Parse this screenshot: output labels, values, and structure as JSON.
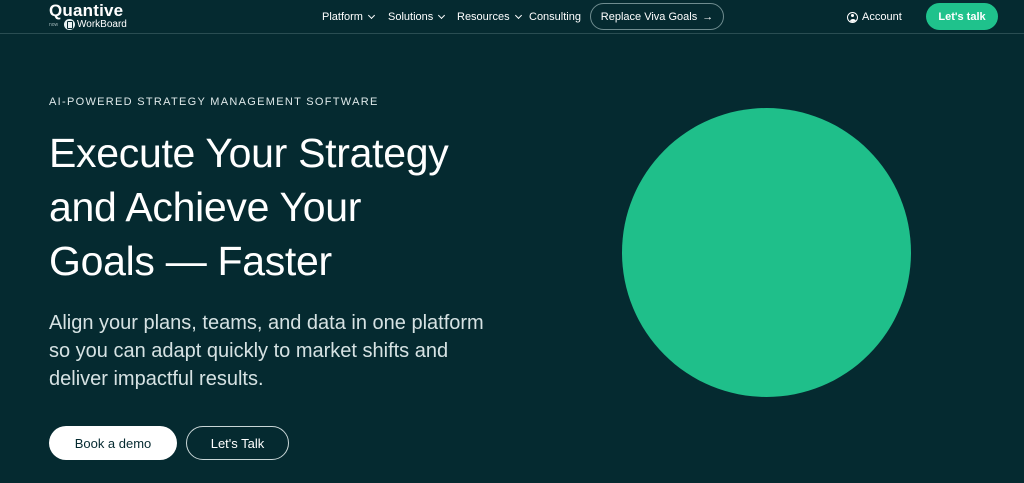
{
  "nav": {
    "logo": {
      "name": "Quantive",
      "now": "now",
      "partner": "WorkBoard"
    },
    "items": [
      {
        "label": "Platform"
      },
      {
        "label": "Solutions"
      },
      {
        "label": "Resources"
      },
      {
        "label": "Consulting"
      }
    ],
    "replace_label": "Replace Viva Goals",
    "replace_arrow": "→",
    "account_label": "Account",
    "cta_label": "Let's talk"
  },
  "hero": {
    "eyebrow": "AI-POWERED STRATEGY MANAGEMENT SOFTWARE",
    "headline_lines": [
      "Execute Your Strategy",
      "and Achieve Your",
      "Goals — Faster"
    ],
    "subtext_lines": [
      "Align your plans, teams, and data in one platform",
      "so you can adapt quickly to market shifts and",
      "deliver impactful results."
    ],
    "primary_button": "Book a demo",
    "secondary_button": "Let's Talk"
  },
  "colors": {
    "background": "#052a30",
    "accent": "#1fc28c",
    "circle": "#1fbf8a"
  },
  "icons": [
    "workboard-logo-icon",
    "chevron-down-icon",
    "arrow-right-icon",
    "user-icon"
  ]
}
